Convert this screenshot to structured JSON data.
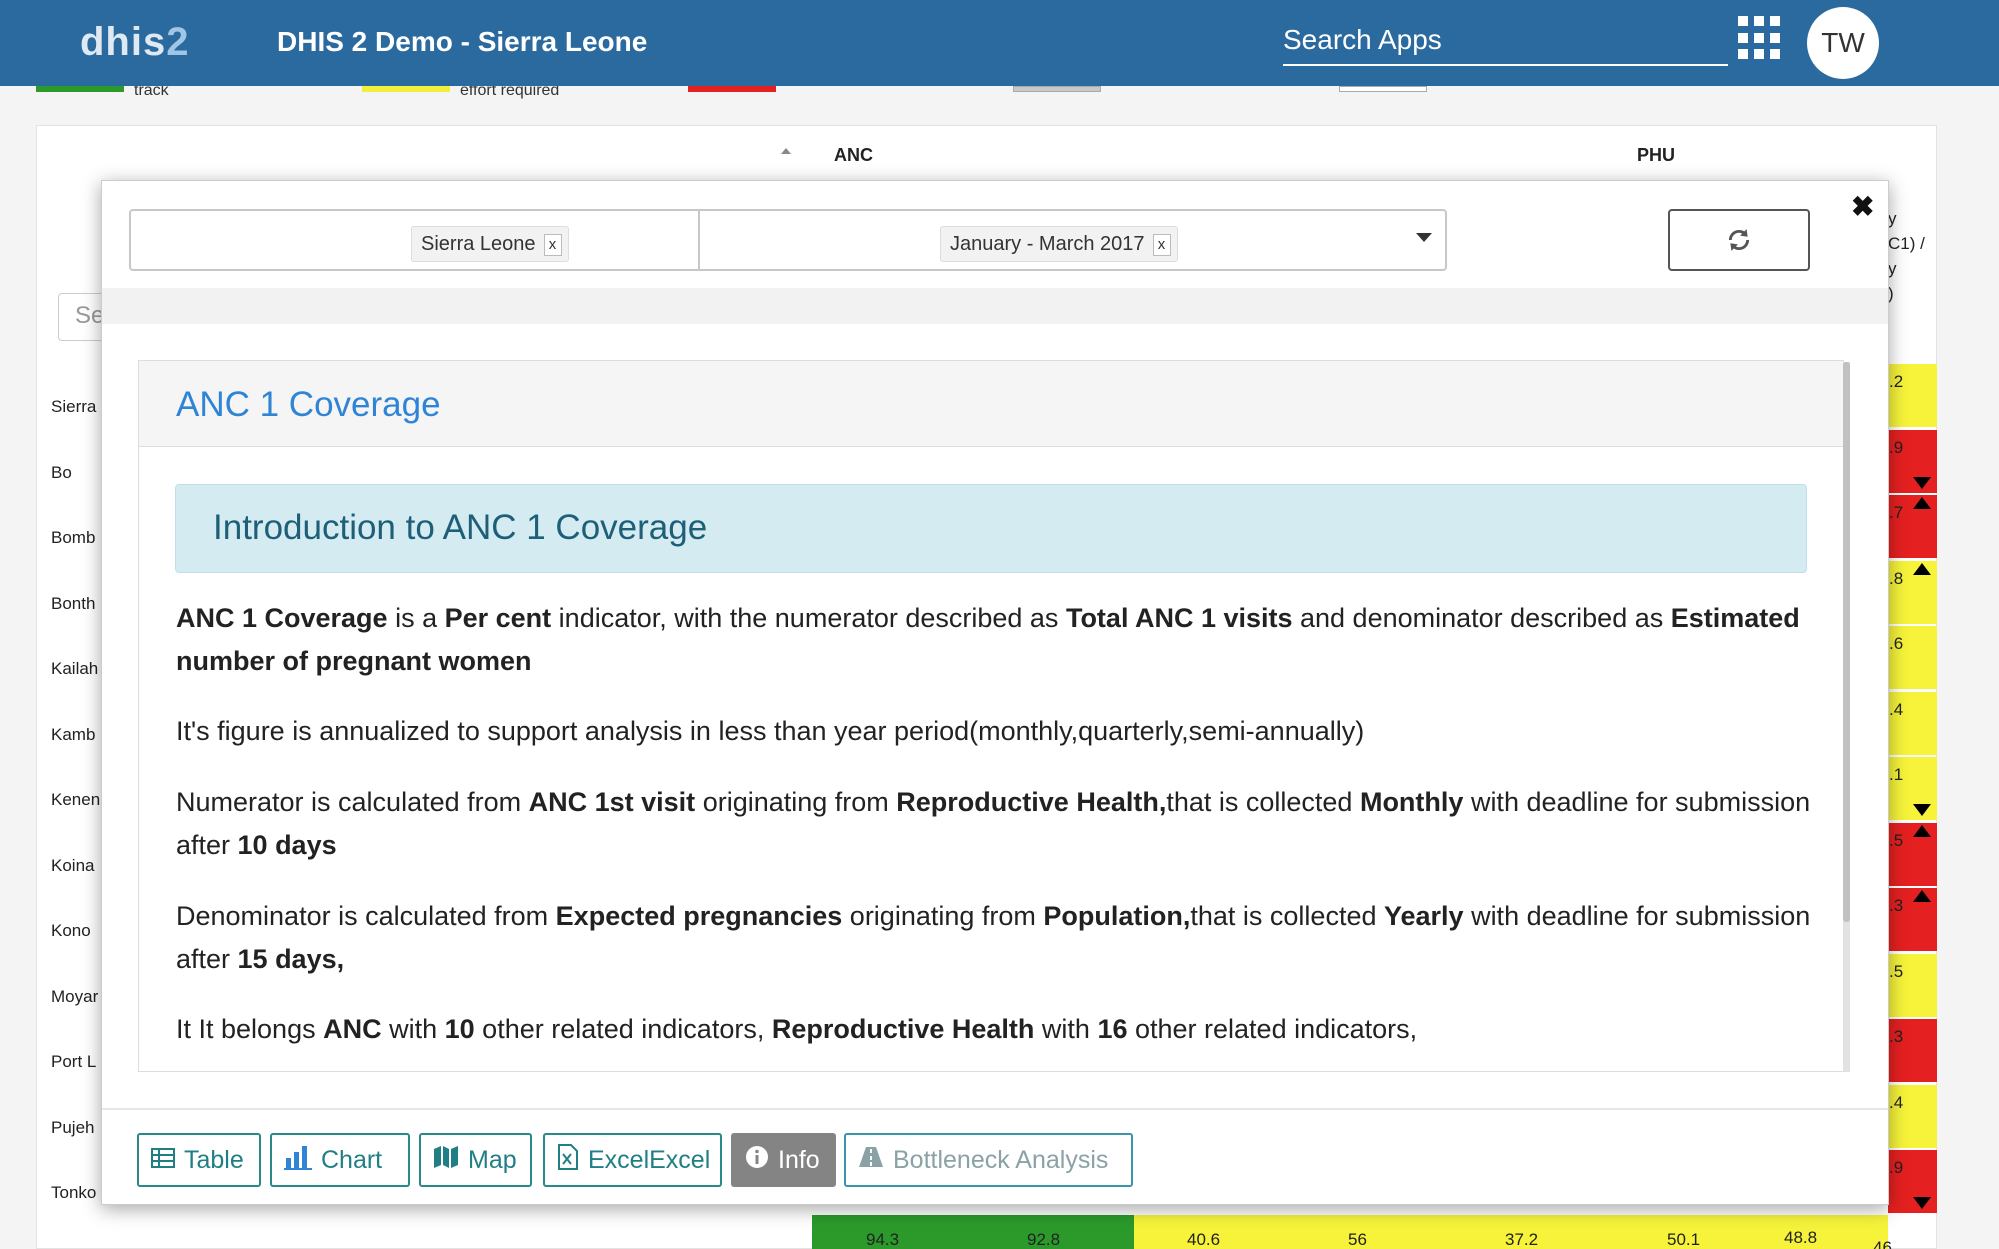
{
  "header": {
    "logo_main": "dhis",
    "logo_num": "2",
    "title": "DHIS 2 Demo - Sierra Leone",
    "search_placeholder": "Search Apps",
    "avatar_initials": "TW"
  },
  "background": {
    "legend": [
      {
        "color": "#2b9a2b",
        "text": "track"
      },
      {
        "color": "#f0f03a",
        "text": "effort required"
      },
      {
        "color": "#e52020",
        "text": ""
      },
      {
        "color": "#c8c8c8",
        "text": ""
      },
      {
        "color": "#ffffff",
        "text": ""
      }
    ],
    "columns": [
      "ANC",
      "PHU"
    ],
    "search_placeholder": "Se",
    "rows": [
      {
        "label": "Sierra",
        "value": ".2",
        "color": "#f6f33a",
        "arrow": ""
      },
      {
        "label": "Bo",
        "value": ".9",
        "color": "#e52020",
        "arrow": "down"
      },
      {
        "label": "Bomb",
        "value": ".7",
        "color": "#e52020",
        "arrow": "up"
      },
      {
        "label": "Bonth",
        "value": ".8",
        "color": "#f6f33a",
        "arrow": "up"
      },
      {
        "label": "Kailah",
        "value": ".6",
        "color": "#f6f33a",
        "arrow": ""
      },
      {
        "label": "Kamb",
        "value": ".4",
        "color": "#f6f33a",
        "arrow": ""
      },
      {
        "label": "Kenen",
        "value": ".1",
        "color": "#f6f33a",
        "arrow": "down"
      },
      {
        "label": "Koina",
        "value": ".5",
        "color": "#e52020",
        "arrow": "up"
      },
      {
        "label": "Kono",
        "value": ".3",
        "color": "#e52020",
        "arrow": "up"
      },
      {
        "label": "Moyar",
        "value": ".5",
        "color": "#f6f33a",
        "arrow": ""
      },
      {
        "label": "Port L",
        "value": ".3",
        "color": "#e52020",
        "arrow": ""
      },
      {
        "label": "Pujeh",
        "value": ".4",
        "color": "#f6f33a",
        "arrow": ""
      },
      {
        "label": "Tonko",
        "value": ".9",
        "color": "#e52020",
        "arrow": "down"
      }
    ],
    "right_header_fragment": [
      "y",
      "C1) /",
      "y",
      "",
      ")"
    ],
    "bottom_values": [
      "94.3",
      "92.8",
      "40.6",
      "56",
      "37.2",
      "50.1",
      "48.8",
      "46"
    ]
  },
  "modal": {
    "org_unit_chip": "Sierra Leone",
    "period_chip": "January - March 2017",
    "chip_remove": "x",
    "close_symbol": "✖",
    "panel_title": "ANC 1 Coverage",
    "intro_heading": "Introduction to ANC 1 Coverage",
    "p1": {
      "indicator": "ANC 1 Coverage",
      "t1": " is a ",
      "type": "Per cent",
      "t2": " indicator, with the numerator described as ",
      "numerator": "Total ANC 1 visits",
      "t3": " and denominator described as ",
      "denominator": "Estimated number of pregnant women"
    },
    "p2": "It's figure is annualized to support analysis in less than year period(monthly,quarterly,semi-annually)",
    "p3": {
      "t1": "Numerator is calculated from ",
      "element": "ANC 1st visit",
      "t2": " originating from ",
      "source": "Reproductive Health,",
      "t3": "that is collected ",
      "frequency": "Monthly",
      "t4": " with deadline for submission after ",
      "deadline": "10 days"
    },
    "p4": {
      "t1": "Denominator is calculated from ",
      "element": "Expected pregnancies",
      "t2": " originating from ",
      "source": "Population,",
      "t3": "that is collected ",
      "frequency": "Yearly",
      "t4": " with deadline for submission after ",
      "deadline": "15 days,"
    },
    "p5": {
      "t1": "It It belongs ",
      "group1": "ANC",
      "t2": " with ",
      "count1": "10",
      "t3": " other related indicators, ",
      "group2": "Reproductive Health",
      "t4": " with ",
      "count2": "16",
      "t5": " other related indicators,"
    },
    "footer_buttons": [
      {
        "label": "Table",
        "icon": "table-icon"
      },
      {
        "label": "Chart",
        "icon": "bar-chart-icon"
      },
      {
        "label": "Map",
        "icon": "map-icon"
      },
      {
        "label": "ExcelExcel",
        "icon": "excel-file-icon"
      },
      {
        "label": "Info",
        "icon": "info-icon"
      },
      {
        "label": "Bottleneck Analysis",
        "icon": "road-icon"
      }
    ]
  },
  "colors": {
    "header_bg": "#2a6a9e",
    "title_link": "#2f84d6",
    "alert_bg": "#d4ebf2",
    "button_teal": "#1f7f85",
    "info_active": "#848484"
  }
}
